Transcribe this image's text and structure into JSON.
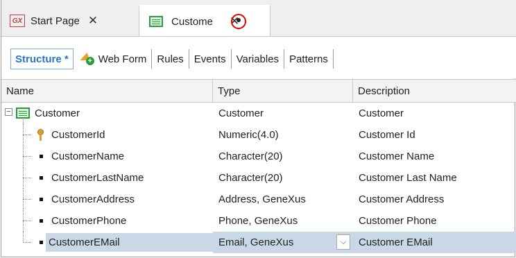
{
  "tabs": [
    {
      "label": "Start Page",
      "icon": "gx-icon",
      "close": "✕"
    },
    {
      "label": "Custome",
      "icon": "transaction-icon",
      "close": "✕",
      "modified": true
    }
  ],
  "subtabs": {
    "structure": "Structure *",
    "webform": "Web Form",
    "rules": "Rules",
    "events": "Events",
    "variables": "Variables",
    "patterns": "Patterns"
  },
  "grid": {
    "columns": {
      "name": "Name",
      "type": "Type",
      "description": "Description"
    },
    "root": {
      "name": "Customer",
      "type": "Customer",
      "description": "Customer"
    },
    "attributes": [
      {
        "name": "CustomerId",
        "type": "Numeric(4.0)",
        "description": "Customer Id",
        "key": true
      },
      {
        "name": "CustomerName",
        "type": "Character(20)",
        "description": "Customer Name"
      },
      {
        "name": "CustomerLastName",
        "type": "Character(20)",
        "description": "Customer Last Name"
      },
      {
        "name": "CustomerAddress",
        "type": "Address, GeneXus",
        "description": "Customer Address"
      },
      {
        "name": "CustomerPhone",
        "type": "Phone, GeneXus",
        "description": "Customer Phone"
      },
      {
        "name": "CustomerEMail",
        "type": "Email, GeneXus",
        "description": "Customer EMail",
        "selected": true
      }
    ]
  },
  "colors": {
    "accent": "#2a76c6",
    "selection": "#c9d7e7",
    "modified_marker": "#e00000"
  }
}
